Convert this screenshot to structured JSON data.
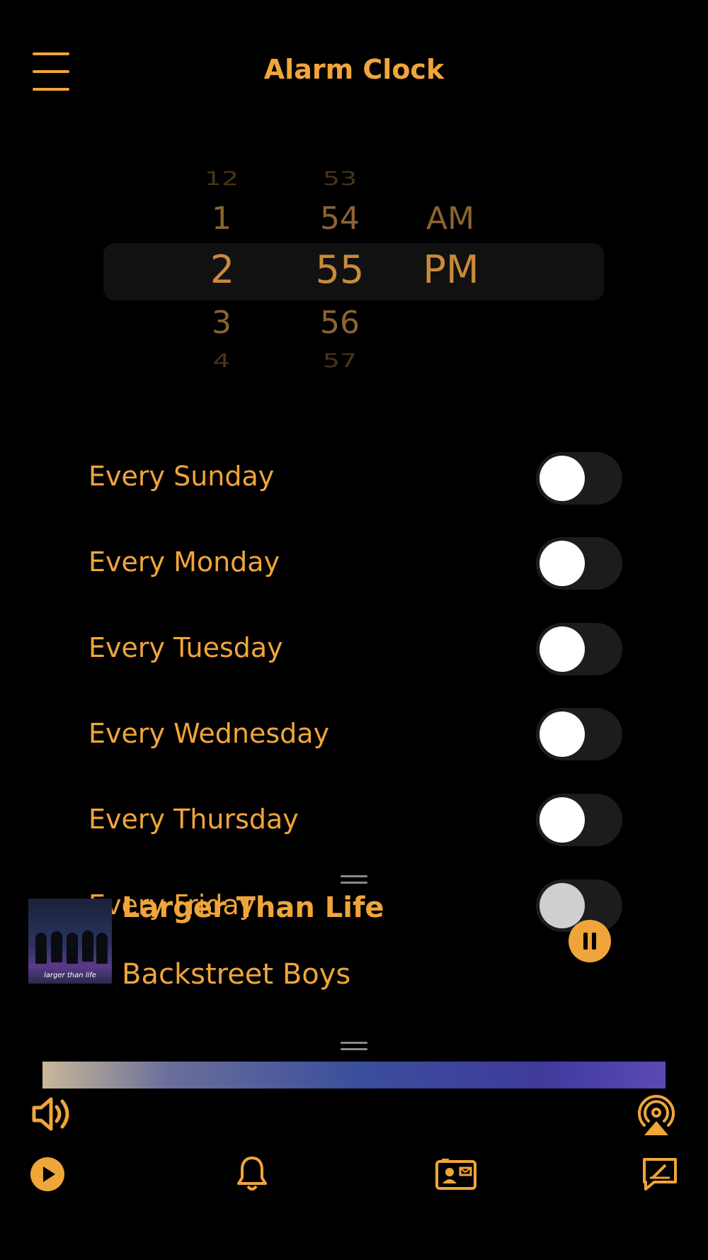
{
  "header": {
    "title": "Alarm Clock"
  },
  "picker": {
    "hours": {
      "far_above": "12",
      "above": "1",
      "selected": "2",
      "below": "3",
      "far_below": "4"
    },
    "minutes": {
      "far_above": "53",
      "above": "54",
      "selected": "55",
      "below": "56",
      "far_below": "57"
    },
    "period": {
      "above": "AM",
      "selected": "PM"
    }
  },
  "repeat": [
    {
      "label": "Every Sunday",
      "on": false
    },
    {
      "label": "Every Monday",
      "on": false
    },
    {
      "label": "Every Tuesday",
      "on": false
    },
    {
      "label": "Every Wednesday",
      "on": false
    },
    {
      "label": "Every Thursday",
      "on": false
    },
    {
      "label": "Every Friday",
      "on": false
    }
  ],
  "now_playing": {
    "title": "Larger Than Life",
    "artist": "Backstreet Boys",
    "album_caption": "larger than life"
  },
  "colors": {
    "accent": "#f0a53a",
    "background": "#000000",
    "toggle_track": "#1c1c1e"
  },
  "icons": [
    "menu-icon",
    "volume-icon",
    "airplay-icon",
    "play-icon",
    "bell-icon",
    "contact-card-icon",
    "compose-icon",
    "pause-icon",
    "drag-handle-icon"
  ]
}
